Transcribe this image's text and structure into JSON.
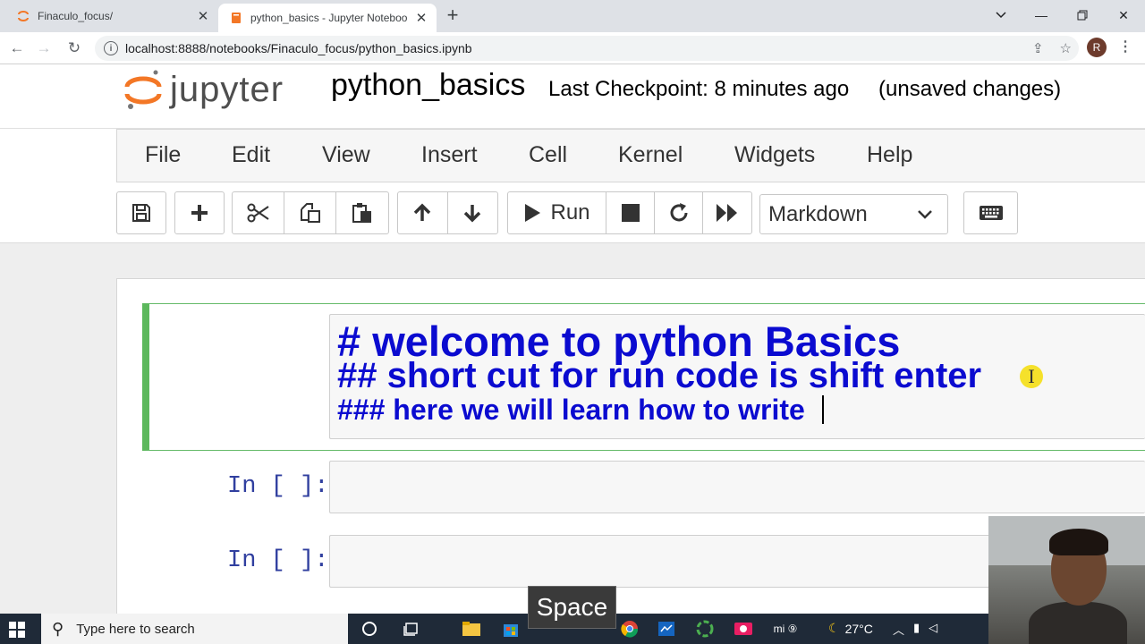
{
  "browser": {
    "tabs": [
      {
        "title": "Finaculo_focus/",
        "active": false
      },
      {
        "title": "python_basics - Jupyter Noteboo",
        "active": true
      }
    ],
    "url": "localhost:8888/notebooks/Finaculo_focus/python_basics.ipynb",
    "profile_initial": "R"
  },
  "jupyter": {
    "logo_text": "jupyter",
    "notebook_name": "python_basics",
    "checkpoint": "Last Checkpoint: 8 minutes ago",
    "status": "(unsaved changes)",
    "menu": [
      "File",
      "Edit",
      "View",
      "Insert",
      "Cell",
      "Kernel",
      "Widgets",
      "Help"
    ],
    "toolbar": {
      "run_label": "Run",
      "cell_type": "Markdown"
    }
  },
  "cells": {
    "markdown_lines": [
      "# welcome to python Basics",
      "## short cut for run code is shift enter",
      "### here we will learn how to write "
    ],
    "code_prompts": [
      "In [ ]:",
      "In [ ]:"
    ]
  },
  "overlay": {
    "key_pressed": "Space"
  },
  "taskbar": {
    "search_placeholder": "Type here to search",
    "temperature": "27°C"
  },
  "colors": {
    "markdown_text": "#0b0bd0",
    "selected_cell_border": "#5cb85c",
    "prompt": "#303f9f"
  }
}
